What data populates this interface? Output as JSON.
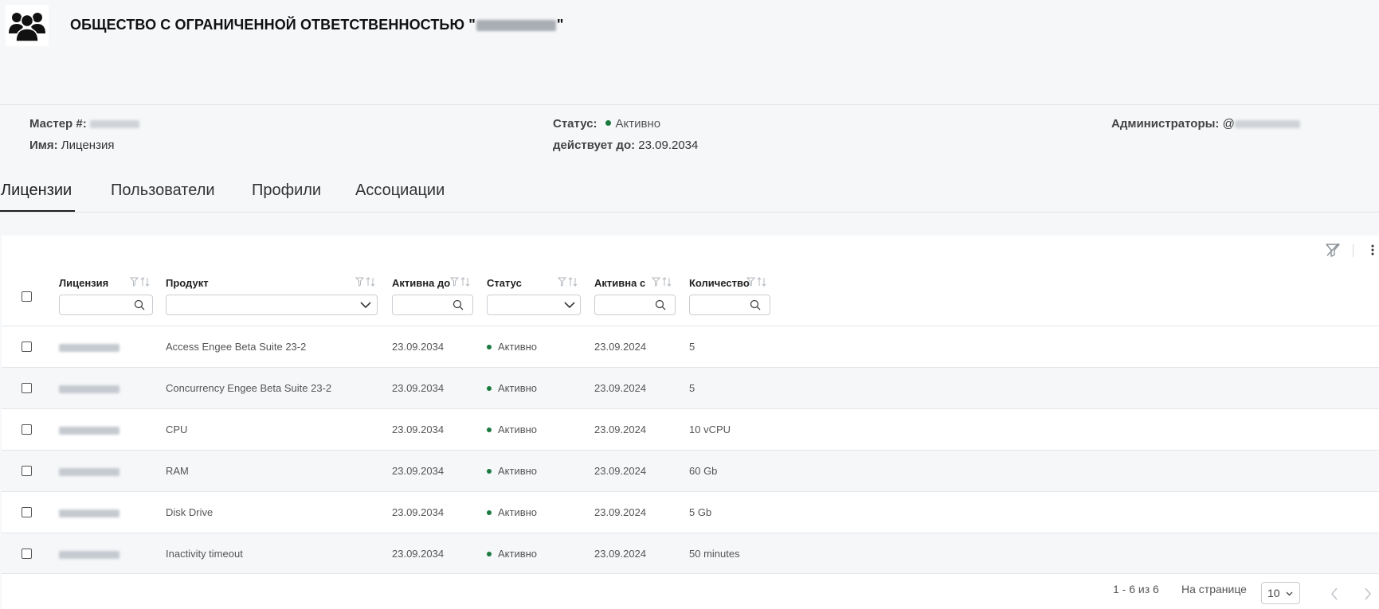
{
  "header": {
    "logo_icon": "users-group-icon",
    "company_prefix": "ОБЩЕСТВО С ОГРАНИЧЕННОЙ ОТВЕТСТВЕННОСТЬЮ \"",
    "company_suffix": "\""
  },
  "info": {
    "master_label": "Мастер #:",
    "name_label": "Имя:",
    "name_value": "Лицензия",
    "status_label": "Статус:",
    "status_value": "Активно",
    "valid_until_label": "действует до:",
    "valid_until_value": "23.09.2034",
    "admins_label": "Администраторы:",
    "admins_prefix": "@"
  },
  "tabs": [
    {
      "label": "Лицензии"
    },
    {
      "label": "Пользователи"
    },
    {
      "label": "Профили"
    },
    {
      "label": "Ассоциации"
    }
  ],
  "table": {
    "columns": [
      "Лицензия",
      "Продукт",
      "Активна до",
      "Статус",
      "Активна с",
      "Количество"
    ],
    "rows": [
      {
        "product": "Access Engee Beta Suite 23-2",
        "active_until": "23.09.2034",
        "status": "Активно",
        "active_from": "23.09.2024",
        "quantity": "5"
      },
      {
        "product": "Concurrency Engee Beta Suite 23-2",
        "active_until": "23.09.2034",
        "status": "Активно",
        "active_from": "23.09.2024",
        "quantity": "5"
      },
      {
        "product": "CPU",
        "active_until": "23.09.2034",
        "status": "Активно",
        "active_from": "23.09.2024",
        "quantity": "10 vCPU"
      },
      {
        "product": "RAM",
        "active_until": "23.09.2034",
        "status": "Активно",
        "active_from": "23.09.2024",
        "quantity": "60 Gb"
      },
      {
        "product": "Disk Drive",
        "active_until": "23.09.2034",
        "status": "Активно",
        "active_from": "23.09.2024",
        "quantity": "5 Gb"
      },
      {
        "product": "Inactivity timeout",
        "active_until": "23.09.2034",
        "status": "Активно",
        "active_from": "23.09.2024",
        "quantity": "50 minutes"
      }
    ]
  },
  "pagination": {
    "range": "1 - 6 из 6",
    "per_page_label": "На странице",
    "per_page_value": "10"
  },
  "colors": {
    "status_active": "#1b7a3e",
    "background": "#f6f7f9"
  }
}
